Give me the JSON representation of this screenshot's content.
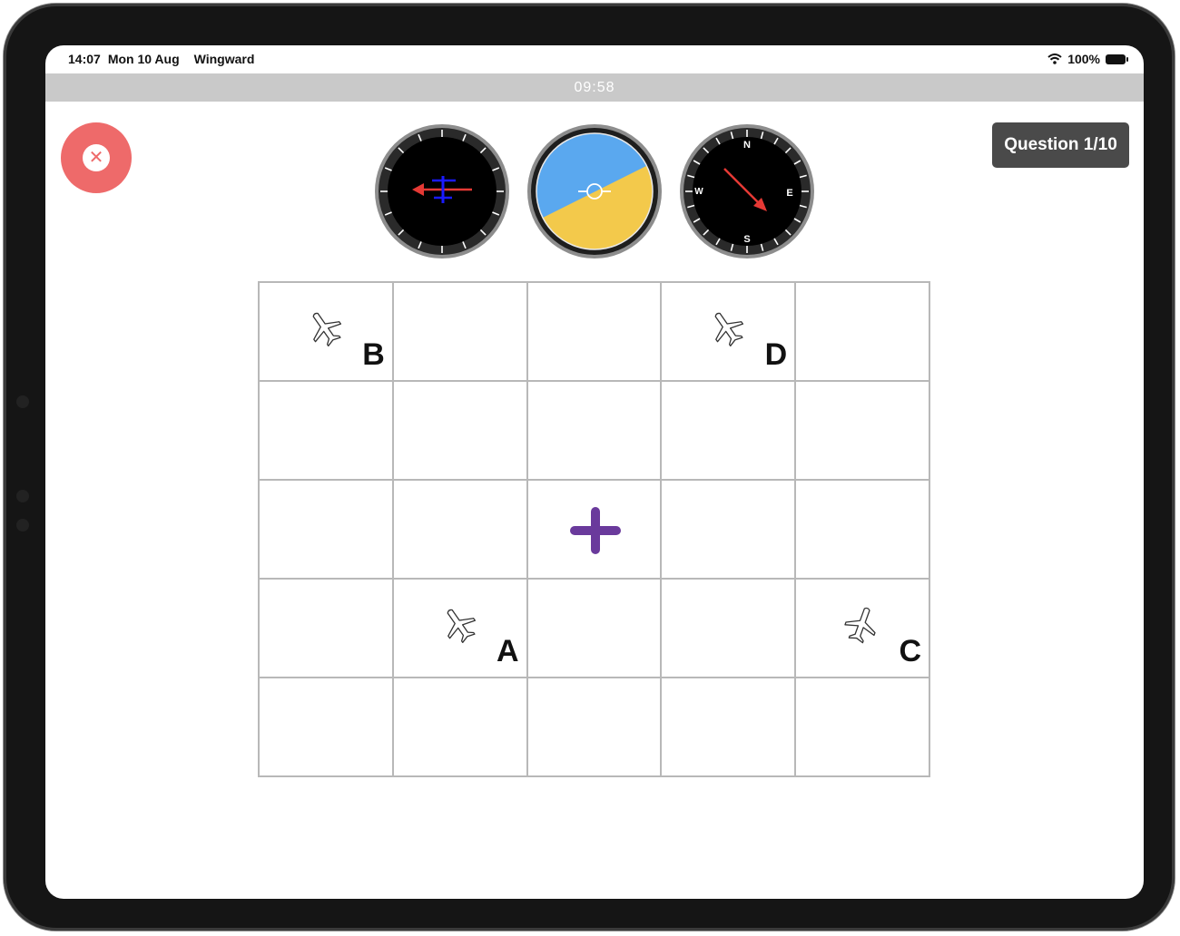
{
  "status": {
    "time": "14:07",
    "date": "Mon 10 Aug",
    "app_name": "Wingward",
    "battery": "100%",
    "wifi_icon": "wifi-icon",
    "battery_icon": "battery-icon"
  },
  "timer": {
    "label": "09:58"
  },
  "close_button": {
    "icon": "close-icon",
    "color": "#ee6a6a"
  },
  "question": {
    "label": "Question 1/10"
  },
  "instruments": {
    "turn_coordinator": {
      "icon": "turn-coordinator-icon",
      "pointer_color": "#e53935",
      "marker_color": "#1a1aff"
    },
    "attitude_indicator": {
      "icon": "attitude-indicator-icon",
      "sky_color": "#5aa8ef",
      "ground_color": "#f3c94b"
    },
    "heading_indicator": {
      "icon": "heading-indicator-icon",
      "cardinals": {
        "n": "N",
        "e": "E",
        "s": "S",
        "w": "W"
      },
      "heading_deg": 135,
      "pointer_color": "#e53935"
    }
  },
  "grid": {
    "rows": 5,
    "cols": 5,
    "options": [
      {
        "letter": "B",
        "row": 0,
        "col": 0,
        "icon": "airplane-icon"
      },
      {
        "letter": "D",
        "row": 0,
        "col": 3,
        "icon": "airplane-icon"
      },
      {
        "letter": "A",
        "row": 3,
        "col": 1,
        "icon": "airplane-icon"
      },
      {
        "letter": "C",
        "row": 3,
        "col": 4,
        "icon": "airplane-icon"
      }
    ],
    "center_icon": "plus-icon",
    "center_color": "#6a3a9c"
  }
}
